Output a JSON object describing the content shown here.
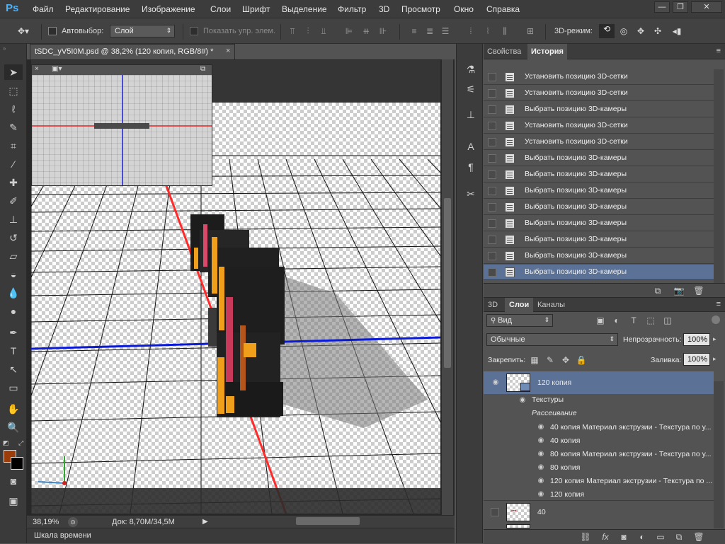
{
  "app": {
    "logo": "Ps"
  },
  "menu": [
    "Файл",
    "Редактирование",
    "Изображение",
    "Слои",
    "Шрифт",
    "Выделение",
    "Фильтр",
    "3D",
    "Просмотр",
    "Окно",
    "Справка"
  ],
  "window_controls": {
    "minimize": "—",
    "restore": "❐",
    "close": "✕"
  },
  "options_bar": {
    "autoselect_label": "Автовыбор:",
    "autoselect_value": "Слой",
    "show_controls_label": "Показать упр. элем.",
    "mode3d_label": "3D-режим:"
  },
  "document": {
    "tab_title": "tSDC_yV5I0M.psd @ 38,2% (120 копия, RGB/8#) *",
    "close": "×",
    "zoom": "38,19%",
    "doc_info": "Док: 8,70M/34,5M"
  },
  "timeline": {
    "label": "Шкала времени"
  },
  "history_panel": {
    "tabs": [
      "Свойства",
      "История"
    ],
    "active_tab": "История",
    "items": [
      "Установить позицию 3D-сетки",
      "Установить позицию 3D-сетки",
      "Выбрать позицию 3D-камеры",
      "Установить позицию 3D-сетки",
      "Установить позицию 3D-сетки",
      "Выбрать позицию 3D-камеры",
      "Выбрать позицию 3D-камеры",
      "Выбрать позицию 3D-камеры",
      "Выбрать позицию 3D-камеры",
      "Выбрать позицию 3D-камеры",
      "Выбрать позицию 3D-камеры",
      "Выбрать позицию 3D-камеры",
      "Выбрать позицию 3D-камеры"
    ],
    "selected_index": 12
  },
  "layers_panel": {
    "tabs": [
      "3D",
      "Слои",
      "Каналы"
    ],
    "active_tab": "Слои",
    "filter_value": "Вид",
    "blend_mode": "Обычные",
    "opacity_label": "Непрозрачность:",
    "opacity_value": "100%",
    "lock_label": "Закрепить:",
    "fill_label": "Заливка:",
    "fill_value": "100%",
    "layer_main": "120 копия",
    "textures_label": "Текстуры",
    "diffuse_label": "Рассеивание",
    "sublayers": [
      "40 копия Материал экструзии - Текстура по у...",
      "40 копия",
      "80 копия Материал экструзии - Текстура по у...",
      "80 копия",
      "120 копия Материал экструзии - Текстура по ...",
      "120 копия"
    ],
    "layer_40": "40"
  },
  "colors": {
    "foreground": "#9a3d0a",
    "background": "#000000",
    "selection": "#5b7195",
    "accent_logo": "#4ab3ff"
  }
}
